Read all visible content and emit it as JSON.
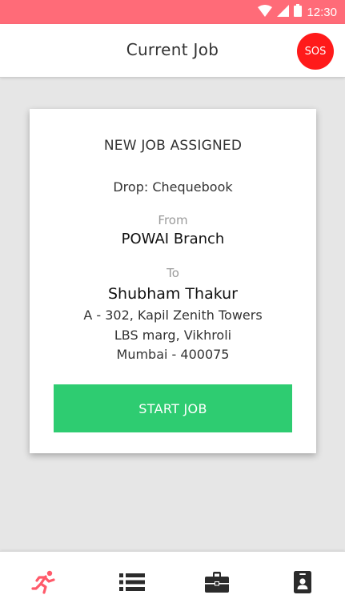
{
  "status_bar": {
    "time": "12:30",
    "icons": [
      "wifi-icon",
      "signal-icon",
      "battery-icon"
    ]
  },
  "header": {
    "title": "Current Job",
    "sos_label": "SOS"
  },
  "job_card": {
    "heading": "NEW JOB ASSIGNED",
    "drop": "Drop: Chequebook",
    "from_label": "From",
    "from_value": "POWAI Branch",
    "to_label": "To",
    "to_name": "Shubham Thakur",
    "address_line1": "A - 302, Kapil Zenith Towers",
    "address_line2": "LBS marg, Vikhroli",
    "address_line3": "Mumbai - 400075",
    "start_label": "START JOB"
  },
  "bottom_nav": {
    "items": [
      {
        "icon": "running-icon",
        "active": true
      },
      {
        "icon": "list-icon",
        "active": false
      },
      {
        "icon": "briefcase-icon",
        "active": false
      },
      {
        "icon": "id-badge-icon",
        "active": false
      }
    ]
  },
  "colors": {
    "status_bar": "#ff6b78",
    "accent_active": "#ff5a6a",
    "sos": "#ff1a1a",
    "start_button": "#2ecc71",
    "background": "#e6e6e6",
    "icon_inactive": "#2b2b2b"
  }
}
